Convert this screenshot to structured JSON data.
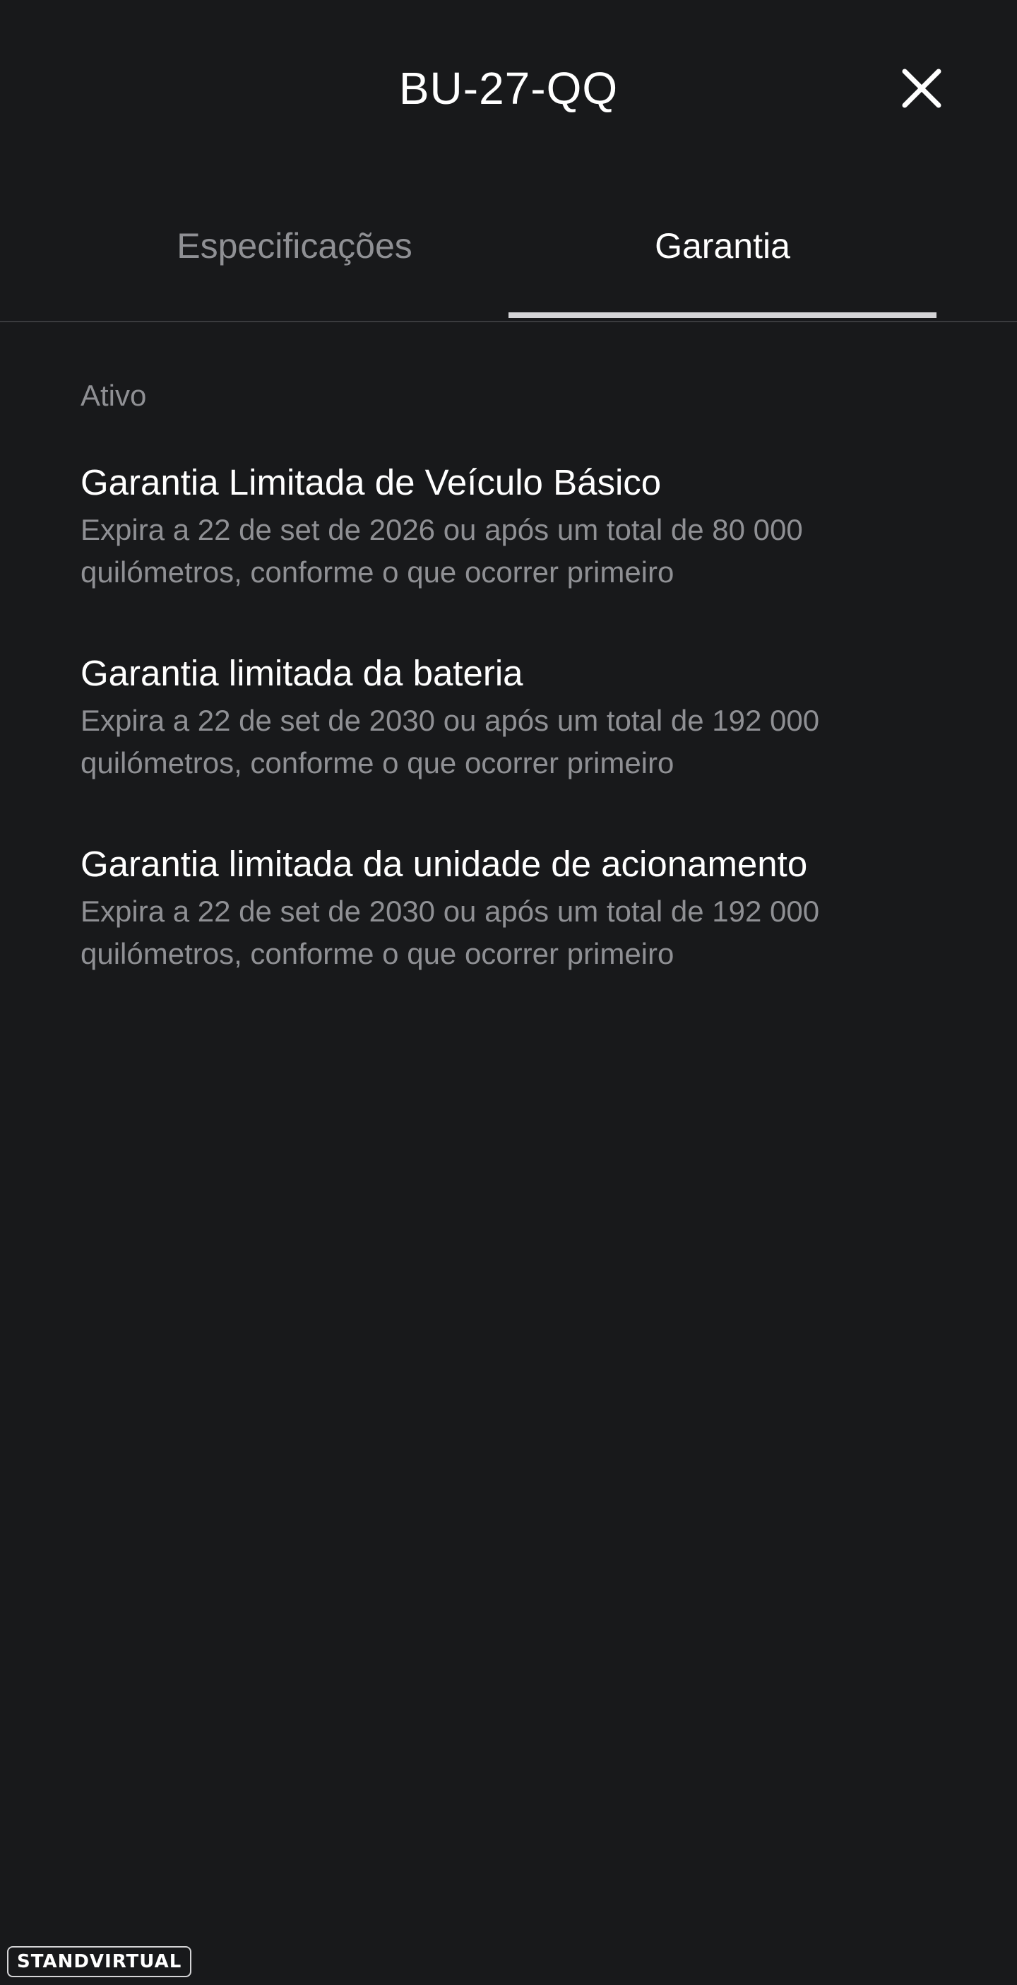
{
  "header": {
    "title": "BU-27-QQ",
    "close_icon": "close-icon"
  },
  "tabs": [
    {
      "label": "Especificações",
      "active": false
    },
    {
      "label": "Garantia",
      "active": true
    }
  ],
  "warranty": {
    "section_label": "Ativo",
    "items": [
      {
        "title": "Garantia Limitada de Veículo Básico",
        "description": "Expira a 22 de set de 2026 ou após um total de 80 000 quilómetros, conforme o que ocorrer primeiro"
      },
      {
        "title": "Garantia limitada da bateria",
        "description": "Expira a 22 de set de 2030 ou após um total de 192 000 quilómetros, conforme o que ocorrer primeiro"
      },
      {
        "title": "Garantia limitada da unidade de acionamento",
        "description": "Expira a 22 de set de 2030 ou após um total de 192 000 quilómetros, conforme o que ocorrer primeiro"
      }
    ]
  },
  "watermark": {
    "text": "STANDVIRTUAL"
  },
  "colors": {
    "background": "#18191b",
    "text_primary": "#ffffff",
    "text_secondary": "#8f9094",
    "tab_indicator": "#d4d4d6",
    "divider": "#3a3b3e"
  }
}
